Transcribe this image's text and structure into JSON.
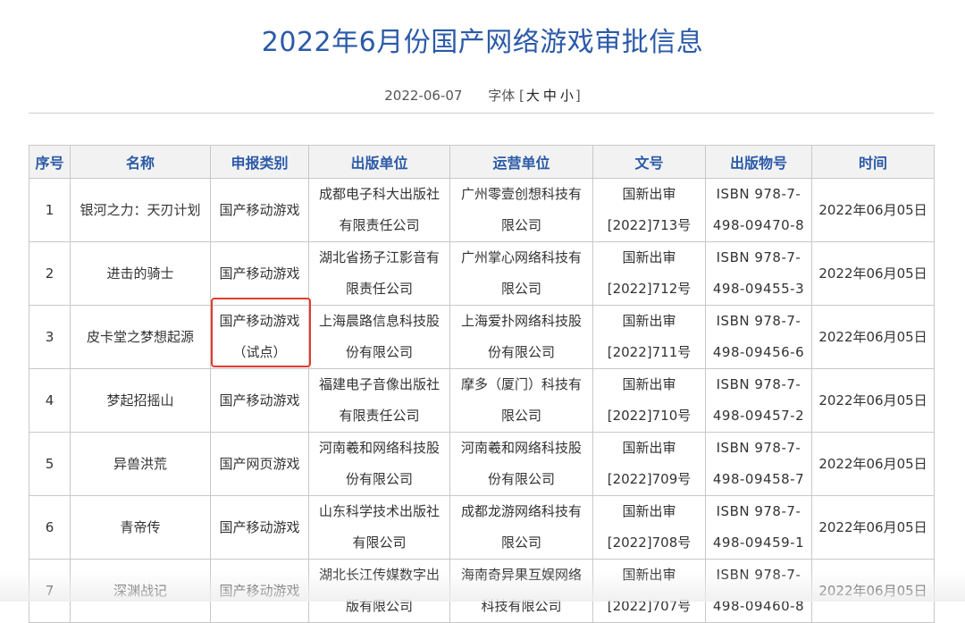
{
  "article": {
    "title": "2022年6月份国产网络游戏审批信息",
    "date": "2022-06-07",
    "font_size": {
      "label": "字体",
      "open": "[",
      "large": "大",
      "medium": "中",
      "small": "小",
      "close": "]"
    }
  },
  "table": {
    "headers": [
      "序号",
      "名称",
      "申报类别",
      "出版单位",
      "运营单位",
      "文号",
      "出版物号",
      "时间"
    ],
    "rows": [
      {
        "idx": "1",
        "name": "银河之力：天刃计划",
        "category": [
          "国产移动游戏"
        ],
        "publisher": [
          "成都电子科大出版社",
          "有限责任公司"
        ],
        "operator": [
          "广州零壹创想科技有",
          "限公司"
        ],
        "doc": [
          "国新出审",
          "[2022]713号"
        ],
        "isbn": [
          "ISBN 978-7-",
          "498-09470-8"
        ],
        "time": "2022年06月05日"
      },
      {
        "idx": "2",
        "name": "进击的骑士",
        "category": [
          "国产移动游戏"
        ],
        "publisher": [
          "湖北省扬子江影音有",
          "限责任公司"
        ],
        "operator": [
          "广州掌心网络科技有",
          "限公司"
        ],
        "doc": [
          "国新出审",
          "[2022]712号"
        ],
        "isbn": [
          "ISBN 978-7-",
          "498-09455-3"
        ],
        "time": "2022年06月05日"
      },
      {
        "idx": "3",
        "name": "皮卡堂之梦想起源",
        "category": [
          "国产移动游戏",
          "（试点）"
        ],
        "publisher": [
          "上海晨路信息科技股",
          "份有限公司"
        ],
        "operator": [
          "上海爱扑网络科技股",
          "份有限公司"
        ],
        "doc": [
          "国新出审",
          "[2022]711号"
        ],
        "isbn": [
          "ISBN 978-7-",
          "498-09456-6"
        ],
        "time": "2022年06月05日"
      },
      {
        "idx": "4",
        "name": "梦起招摇山",
        "category": [
          "国产移动游戏"
        ],
        "publisher": [
          "福建电子音像出版社",
          "有限责任公司"
        ],
        "operator": [
          "摩多（厦门）科技有",
          "限公司"
        ],
        "doc": [
          "国新出审",
          "[2022]710号"
        ],
        "isbn": [
          "ISBN 978-7-",
          "498-09457-2"
        ],
        "time": "2022年06月05日"
      },
      {
        "idx": "5",
        "name": "异兽洪荒",
        "category": [
          "国产网页游戏"
        ],
        "publisher": [
          "河南羲和网络科技股",
          "份有限公司"
        ],
        "operator": [
          "河南羲和网络科技股",
          "份有限公司"
        ],
        "doc": [
          "国新出审",
          "[2022]709号"
        ],
        "isbn": [
          "ISBN 978-7-",
          "498-09458-7"
        ],
        "time": "2022年06月05日"
      },
      {
        "idx": "6",
        "name": "青帝传",
        "category": [
          "国产移动游戏"
        ],
        "publisher": [
          "山东科学技术出版社",
          "有限公司"
        ],
        "operator": [
          "成都龙游网络科技有",
          "限公司"
        ],
        "doc": [
          "国新出审",
          "[2022]708号"
        ],
        "isbn": [
          "ISBN 978-7-",
          "498-09459-1"
        ],
        "time": "2022年06月05日"
      },
      {
        "idx": "7",
        "name": "深渊战记",
        "category": [
          "国产移动游戏"
        ],
        "publisher": [
          "湖北长江传媒数字出",
          "版有限公司"
        ],
        "operator": [
          "海南奇异果互娱网络",
          "科技有限公司"
        ],
        "doc": [
          "国新出审",
          "[2022]707号"
        ],
        "isbn": [
          "ISBN 978-7-",
          "498-09460-8"
        ],
        "time": "2022年06月05日"
      }
    ]
  },
  "colors": {
    "title": "#2b5aa8",
    "header_text": "#2b5aa8",
    "highlight": "#e53a2e"
  }
}
